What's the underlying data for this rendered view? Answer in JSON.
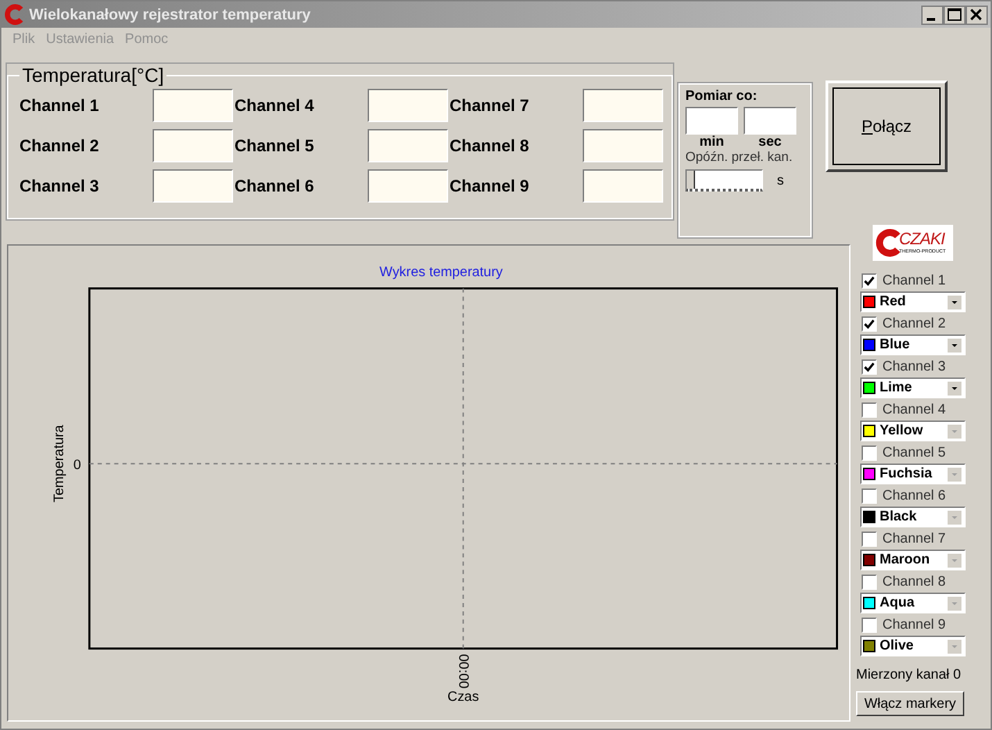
{
  "window": {
    "title": "Wielokanałowy rejestrator temperatury",
    "active": false
  },
  "menu": [
    "Plik",
    "Ustawienia",
    "Pomoc"
  ],
  "temperature_group": {
    "title": "Temperatura[°C]",
    "channels": [
      {
        "label": "Channel 1"
      },
      {
        "label": "Channel 2"
      },
      {
        "label": "Channel 3"
      },
      {
        "label": "Channel 4"
      },
      {
        "label": "Channel 5"
      },
      {
        "label": "Channel 6"
      },
      {
        "label": "Channel 7"
      },
      {
        "label": "Channel 8"
      },
      {
        "label": "Channel 9"
      }
    ]
  },
  "interval_group": {
    "title": "Pomiar co:",
    "min_label": "min",
    "sec_label": "sec",
    "delay_label": "Opóźn. przeł. kan.",
    "delay_slider": {
      "level": 0
    },
    "delay_unit": "s"
  },
  "connect_button": "Połącz",
  "chart": {
    "title": "Wykres temperatury",
    "ylabel": "Temperatura",
    "xlabel": "Czas",
    "ytick": "0",
    "xtick": "00:00"
  },
  "logo": {
    "name": "CZAKI",
    "tagline": "THERMO-PRODUCT"
  },
  "channel_list": [
    {
      "label": "Channel 1",
      "checked": true,
      "color_name": "Red",
      "color": "#ff0000"
    },
    {
      "label": "Channel 2",
      "checked": true,
      "color_name": "Blue",
      "color": "#0000ff"
    },
    {
      "label": "Channel 3",
      "checked": true,
      "color_name": "Lime",
      "color": "#00ff00"
    },
    {
      "label": "Channel 4",
      "checked": false,
      "color_name": "Yellow",
      "color": "#ffff00"
    },
    {
      "label": "Channel 5",
      "checked": false,
      "color_name": "Fuchsia",
      "color": "#ff00ff"
    },
    {
      "label": "Channel 6",
      "checked": false,
      "color_name": "Black",
      "color": "#000000"
    },
    {
      "label": "Channel 7",
      "checked": false,
      "color_name": "Maroon",
      "color": "#800000"
    },
    {
      "label": "Channel 8",
      "checked": false,
      "color_name": "Aqua",
      "color": "#00ffff"
    },
    {
      "label": "Channel 9",
      "checked": false,
      "color_name": "Olive",
      "color": "#808000"
    }
  ],
  "measured_channel": "Mierzony kanał 0",
  "markers_button": "Włącz markery"
}
